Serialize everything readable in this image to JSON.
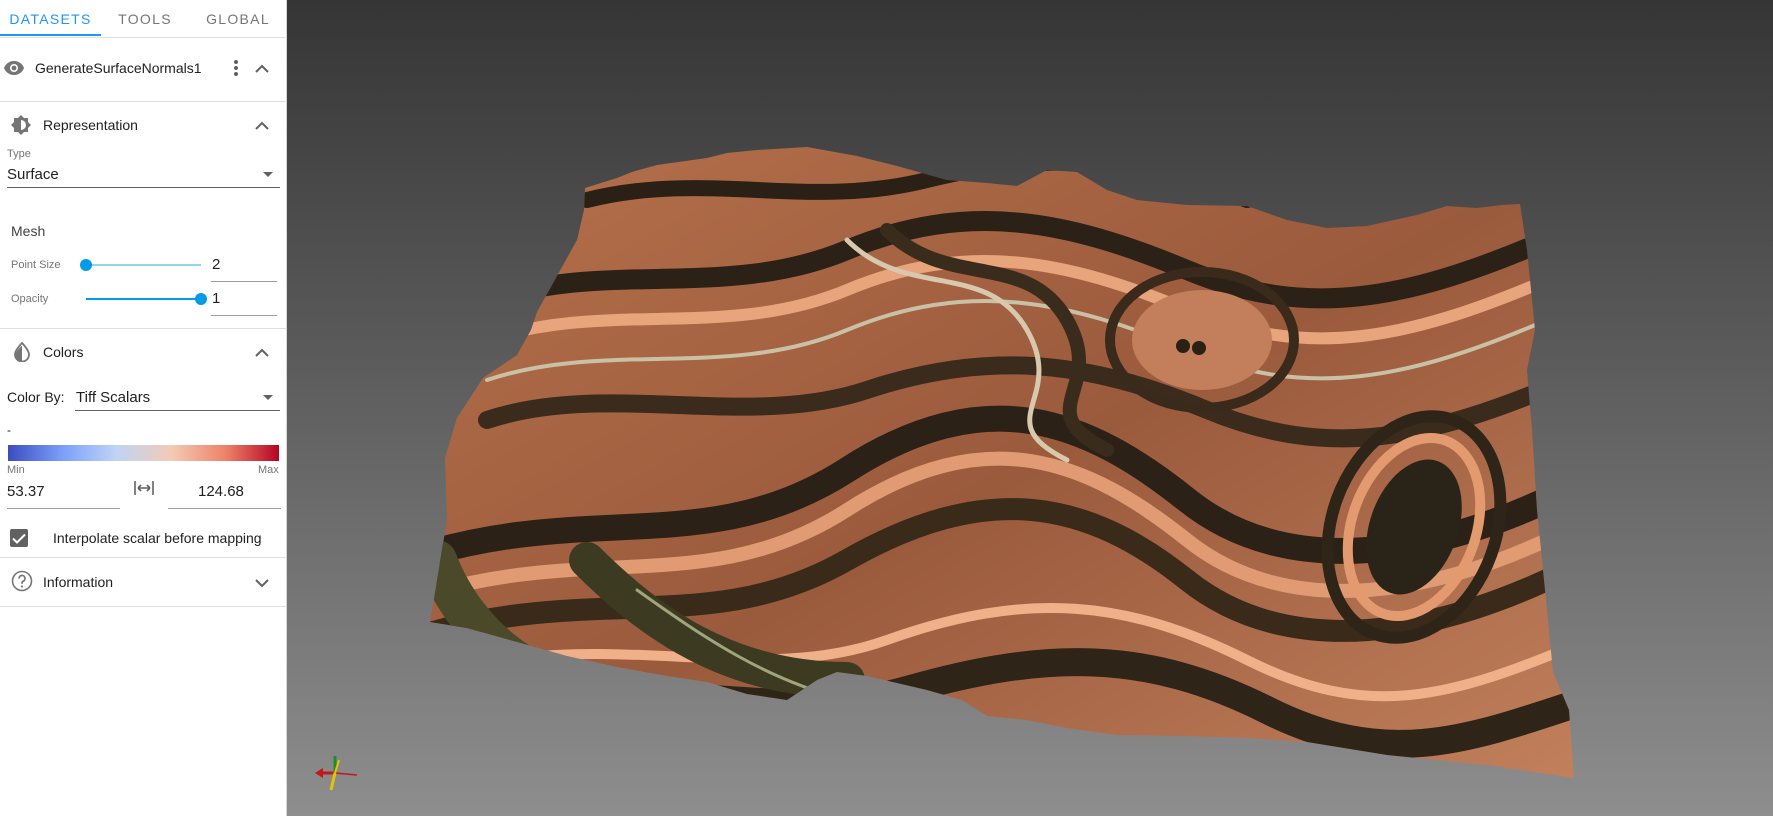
{
  "tabs": [
    {
      "label": "DATASETS"
    },
    {
      "label": "TOOLS"
    },
    {
      "label": "GLOBAL"
    }
  ],
  "dataset": {
    "name": "GenerateSurfaceNormals1",
    "icons": {
      "visibility": "eye-icon",
      "menu": "more-vert-icon",
      "collapse": "chevron-up-icon"
    }
  },
  "representation": {
    "title": "Representation",
    "type_label": "Type",
    "type_value": "Surface"
  },
  "mesh": {
    "title": "Mesh",
    "point_size_label": "Point Size",
    "point_size_value": "2",
    "point_size_fraction": 0.0,
    "opacity_label": "Opacity",
    "opacity_value": "1",
    "opacity_fraction": 1.0
  },
  "colors": {
    "title": "Colors",
    "color_by_label": "Color By:",
    "color_by_value": "Tiff Scalars",
    "preset_text": "-",
    "min_label": "Min",
    "max_label": "Max",
    "min_value": "53.37",
    "max_value": "124.68",
    "interpolate_label": "Interpolate scalar before mapping",
    "interpolate_checked": true,
    "colormap": [
      "#3b4cc0",
      "#7b9ff9",
      "#c0d4f5",
      "#f2cbb7",
      "#ee8468",
      "#b40426"
    ]
  },
  "information": {
    "title": "Information"
  },
  "theme": {
    "accent": "#2196f3",
    "slider": "#039be5"
  }
}
